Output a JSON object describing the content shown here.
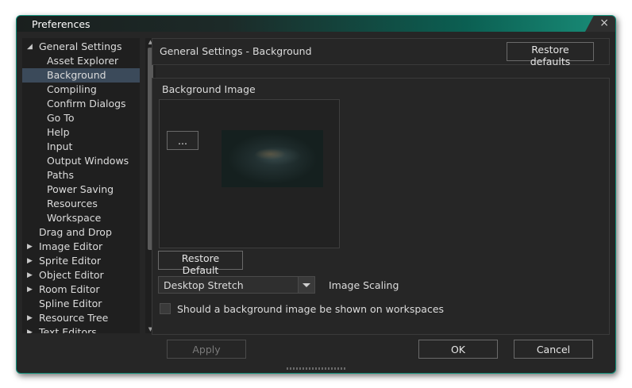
{
  "window": {
    "title": "Preferences",
    "close_glyph": "×"
  },
  "tree": {
    "items": [
      {
        "label": "General Settings",
        "expander": "◢",
        "level": 0
      },
      {
        "label": "Asset Explorer",
        "expander": "",
        "level": 1
      },
      {
        "label": "Background",
        "expander": "",
        "level": 1,
        "selected": true
      },
      {
        "label": "Compiling",
        "expander": "",
        "level": 1
      },
      {
        "label": "Confirm Dialogs",
        "expander": "",
        "level": 1
      },
      {
        "label": "Go To",
        "expander": "",
        "level": 1
      },
      {
        "label": "Help",
        "expander": "",
        "level": 1
      },
      {
        "label": "Input",
        "expander": "",
        "level": 1
      },
      {
        "label": "Output Windows",
        "expander": "",
        "level": 1
      },
      {
        "label": "Paths",
        "expander": "",
        "level": 1
      },
      {
        "label": "Power Saving",
        "expander": "",
        "level": 1
      },
      {
        "label": "Resources",
        "expander": "",
        "level": 1
      },
      {
        "label": "Workspace",
        "expander": "",
        "level": 1
      },
      {
        "label": "Drag and Drop",
        "expander": "",
        "level": 0
      },
      {
        "label": "Image Editor",
        "expander": "▶",
        "level": 0
      },
      {
        "label": "Sprite Editor",
        "expander": "▶",
        "level": 0
      },
      {
        "label": "Object Editor",
        "expander": "▶",
        "level": 0
      },
      {
        "label": "Room Editor",
        "expander": "▶",
        "level": 0
      },
      {
        "label": "Spline Editor",
        "expander": "",
        "level": 0
      },
      {
        "label": "Resource Tree",
        "expander": "▶",
        "level": 0
      },
      {
        "label": "Text Editors",
        "expander": "▶",
        "level": 0
      }
    ],
    "collapse_glyph": "«",
    "scroll_up_glyph": "▲",
    "scroll_down_glyph": "▼"
  },
  "header": {
    "title": "General Settings - Background",
    "restore_defaults_label": "Restore defaults"
  },
  "background": {
    "section_label": "Background Image",
    "browse_label": "...",
    "restore_default_label": "Restore Default",
    "scaling_value": "Desktop Stretch",
    "scaling_label": "Image Scaling",
    "show_on_workspaces_label": "Should a background image be shown on workspaces",
    "show_on_workspaces_checked": false
  },
  "footer": {
    "apply_label": "Apply",
    "ok_label": "OK",
    "cancel_label": "Cancel"
  },
  "colors": {
    "accent": "#0f8f79",
    "selection": "#3b4a5a",
    "panel": "#262626"
  }
}
